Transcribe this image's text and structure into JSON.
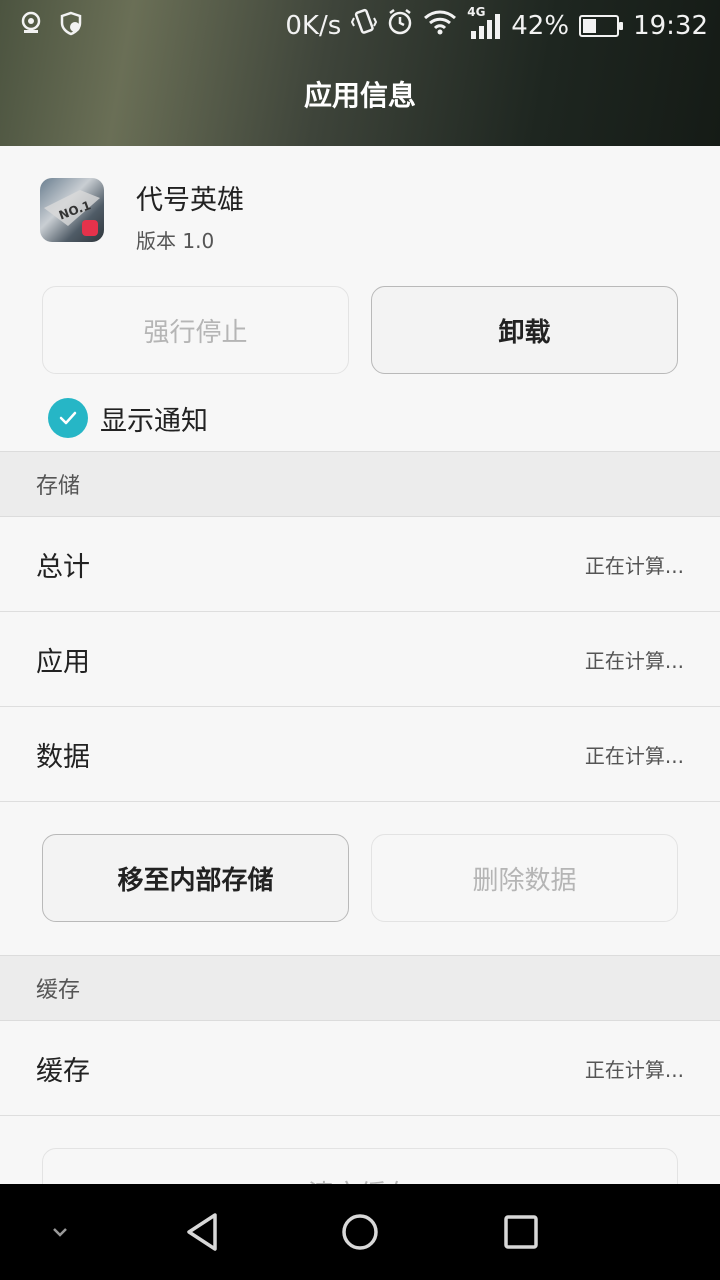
{
  "status_bar": {
    "net_speed": "0K/s",
    "network_label": "4G",
    "battery_percent": "42%",
    "battery_level": 0.42,
    "time": "19:32",
    "icons": [
      "location-icon",
      "shield-icon",
      "vibrate-icon",
      "alarm-icon",
      "wifi-icon",
      "signal-icon",
      "battery-icon"
    ]
  },
  "header": {
    "title": "应用信息"
  },
  "app": {
    "name": "代号英雄",
    "version": "版本 1.0"
  },
  "actions": {
    "force_stop": "强行停止",
    "uninstall": "卸载"
  },
  "notification": {
    "label": "显示通知",
    "checked": true
  },
  "storage": {
    "header": "存储",
    "rows": [
      {
        "label": "总计",
        "value": "正在计算..."
      },
      {
        "label": "应用",
        "value": "正在计算..."
      },
      {
        "label": "数据",
        "value": "正在计算..."
      }
    ],
    "move_button": "移至内部存储",
    "clear_data_button": "删除数据"
  },
  "cache": {
    "header": "缓存",
    "rows": [
      {
        "label": "缓存",
        "value": "正在计算..."
      }
    ],
    "clear_cache_button": "清空缓存"
  },
  "colors": {
    "accent": "#26b6c6",
    "navbar": "#000000"
  }
}
